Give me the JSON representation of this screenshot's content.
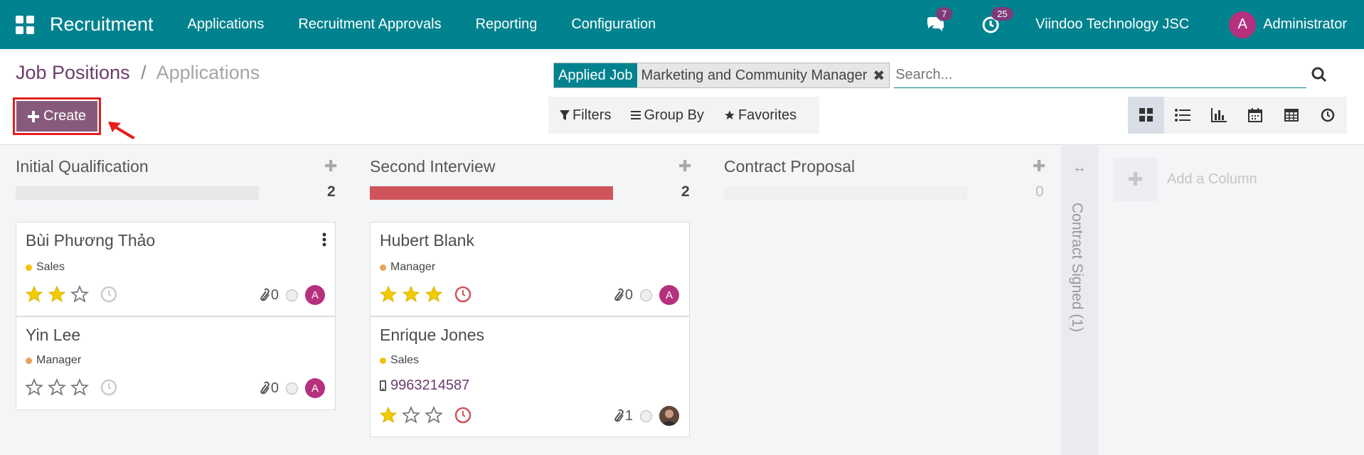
{
  "navbar": {
    "app_name": "Recruitment",
    "menu": [
      "Applications",
      "Recruitment Approvals",
      "Reporting",
      "Configuration"
    ],
    "messages_count": "7",
    "activities_count": "25",
    "company": "Viindoo Technology JSC",
    "user_initial": "A",
    "user_name": "Administrator"
  },
  "breadcrumb": {
    "parent": "Job Positions",
    "separator": "/",
    "current": "Applications"
  },
  "create_label": "Create",
  "search": {
    "facet_category": "Applied Job",
    "facet_value": "Marketing and Community Manager",
    "placeholder": "Search..."
  },
  "filters": {
    "filters_label": "Filters",
    "group_by_label": "Group By",
    "favorites_label": "Favorites"
  },
  "views": [
    "kanban",
    "list",
    "graph",
    "calendar",
    "pivot",
    "activity"
  ],
  "columns": [
    {
      "title": "Initial Qualification",
      "count": "2",
      "cards": [
        {
          "name": "Bùi Phương Thảo",
          "tag": "Sales",
          "tag_color": "#f4c20d",
          "stars": 2,
          "activity": "none",
          "attachments": "0",
          "avatar": "A"
        },
        {
          "name": "Yin Lee",
          "tag": "Manager",
          "tag_color": "#e8a25c",
          "stars": 0,
          "activity": "none",
          "attachments": "0",
          "avatar": "A"
        }
      ]
    },
    {
      "title": "Second Interview",
      "count": "2",
      "cards": [
        {
          "name": "Hubert Blank",
          "tag": "Manager",
          "tag_color": "#e8a25c",
          "stars": 3,
          "activity": "overdue",
          "attachments": "0",
          "avatar": "A"
        },
        {
          "name": "Enrique Jones",
          "tag": "Sales",
          "tag_color": "#f4c20d",
          "phone": "9963214587",
          "stars": 1,
          "activity": "overdue",
          "attachments": "1",
          "avatar": "photo"
        }
      ]
    },
    {
      "title": "Contract Proposal",
      "count": "0",
      "cards": []
    }
  ],
  "folded_column": "Contract Signed (1)",
  "add_column_label": "Add a Column",
  "colors": {
    "navbar": "#00838f",
    "primary": "#875a7b",
    "danger": "#d0555a",
    "star": "#f3cc00",
    "avatar": "#b5307d"
  }
}
